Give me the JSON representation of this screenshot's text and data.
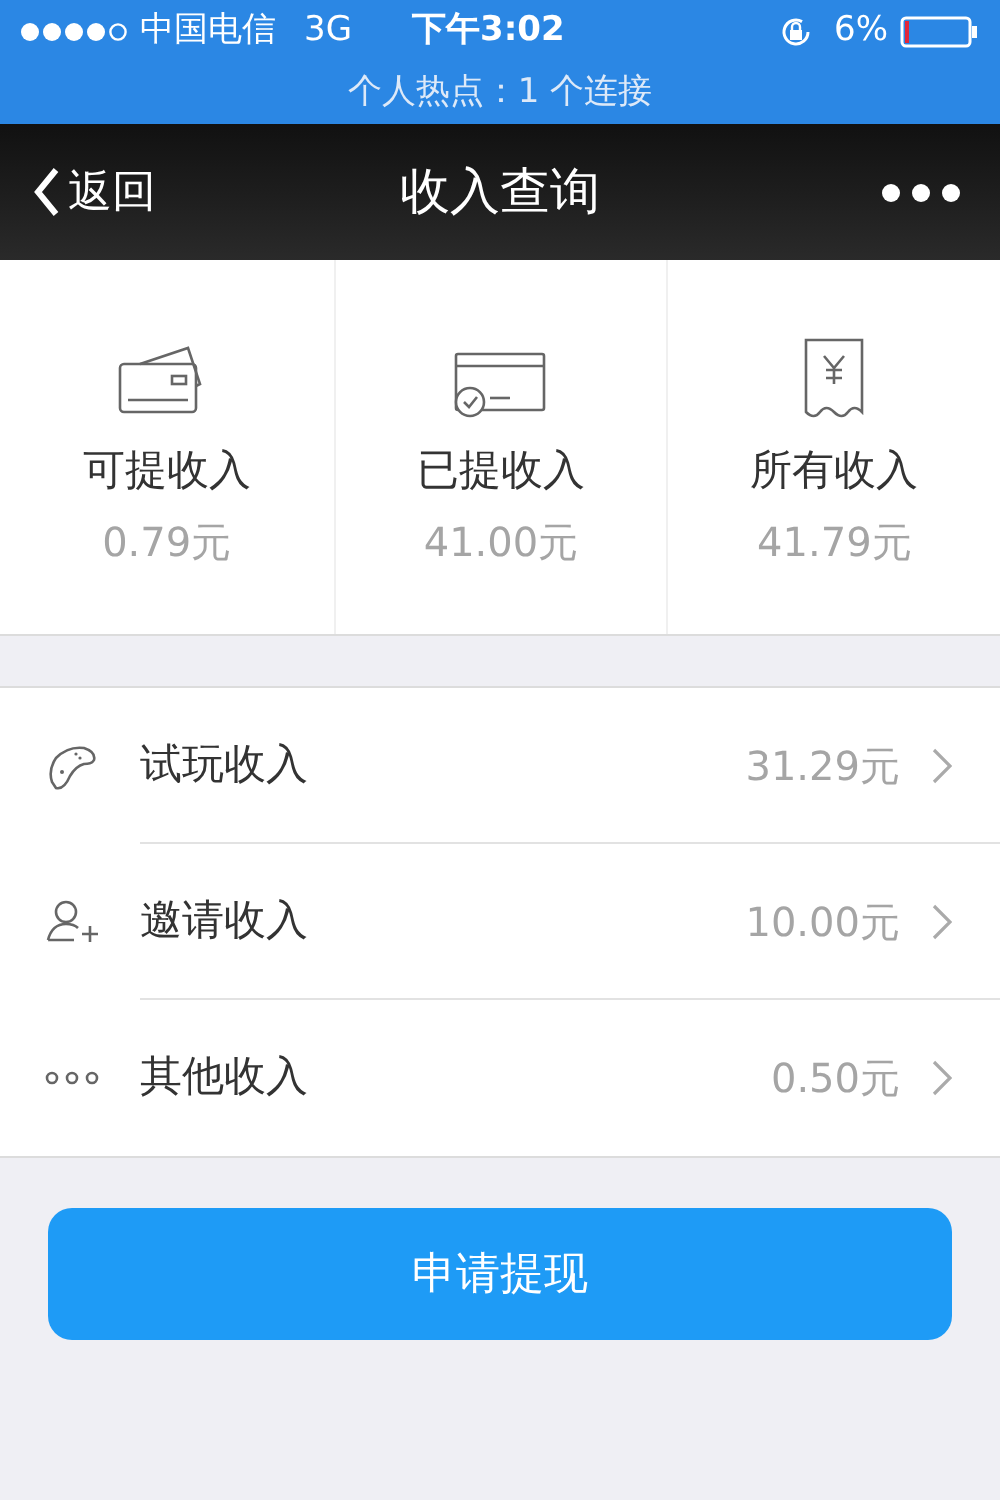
{
  "status_bar": {
    "carrier": "中国电信",
    "network": "3G",
    "time": "下午3:02",
    "battery": "6%",
    "hotspot": "个人热点：1 个连接"
  },
  "nav": {
    "back": "返回",
    "title": "收入查询"
  },
  "summary": [
    {
      "kind": "cards",
      "label": "可提收入",
      "amount": "0.79元"
    },
    {
      "kind": "card-check",
      "label": "已提收入",
      "amount": "41.00元"
    },
    {
      "kind": "receipt",
      "label": "所有收入",
      "amount": "41.79元"
    }
  ],
  "items": [
    {
      "kind": "gamepad",
      "label": "试玩收入",
      "amount": "31.29元"
    },
    {
      "kind": "invite",
      "label": "邀请收入",
      "amount": "10.00元"
    },
    {
      "kind": "dots",
      "label": "其他收入",
      "amount": "0.50元"
    }
  ],
  "button": "申请提现"
}
